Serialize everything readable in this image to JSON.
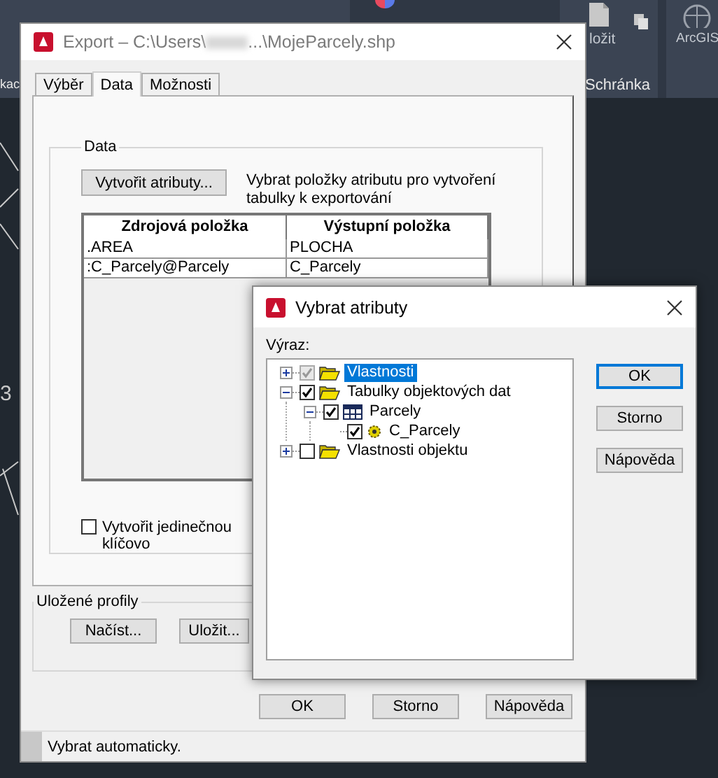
{
  "app_background": {
    "ribbon_labels": [
      {
        "kind": "panel_title",
        "text": "kac"
      },
      {
        "kind": "button",
        "text": "ložit"
      },
      {
        "kind": "panel_title",
        "text": "Schránka"
      },
      {
        "kind": "button",
        "text": "ArcGIS"
      }
    ],
    "canvas_label": "3"
  },
  "export_dialog": {
    "title": "Export – C:\\Users\\",
    "title_end": "...\\MojeParcely.shp",
    "tabs": [
      {
        "label": "Výběr",
        "selected": false
      },
      {
        "label": "Data",
        "selected": true
      },
      {
        "label": "Možnosti",
        "selected": false
      }
    ],
    "data_group": {
      "title": "Data",
      "button": "Vytvořit atributy...",
      "description": "Vybrat položky atributu pro vytvoření tabulky k exportování",
      "table": {
        "columns": [
          "Zdrojová položka",
          "Výstupní položka"
        ],
        "rows": [
          [
            ".AREA",
            "PLOCHA"
          ],
          [
            ":C_Parcely@Parcely",
            "C_Parcely"
          ]
        ]
      },
      "checkbox": {
        "label": "Vytvořit jedinečnou klíčovo",
        "checked": false
      }
    },
    "profiles_group": {
      "title": "Uložené profily",
      "buttons": [
        "Načíst...",
        "Uložit..."
      ]
    },
    "buttons": [
      "OK",
      "Storno",
      "Nápověda"
    ],
    "status_bar": "Vybrat automaticky."
  },
  "inner_dialog": {
    "title": "Vybrat atributy",
    "label": "Výraz:",
    "tree": [
      {
        "label": "Vlastnosti",
        "kind": "folder",
        "checked": true,
        "disabled": true,
        "selected": true,
        "expanded": false
      },
      {
        "label": "Tabulky objektových dat",
        "kind": "folder",
        "checked": true,
        "disabled": false,
        "selected": false,
        "expanded": true,
        "children": [
          {
            "label": "Parcely",
            "kind": "table",
            "checked": true,
            "disabled": false,
            "selected": false,
            "expanded": true,
            "children": [
              {
                "label": "C_Parcely",
                "kind": "field",
                "checked": true,
                "disabled": false,
                "selected": false
              }
            ]
          }
        ]
      },
      {
        "label": "Vlastnosti objektu",
        "kind": "folder",
        "checked": false,
        "disabled": false,
        "selected": false,
        "expanded": false
      }
    ],
    "buttons": [
      {
        "label": "OK",
        "default": true
      },
      {
        "label": "Storno",
        "default": false
      },
      {
        "label": "Nápověda",
        "default": false
      }
    ]
  }
}
